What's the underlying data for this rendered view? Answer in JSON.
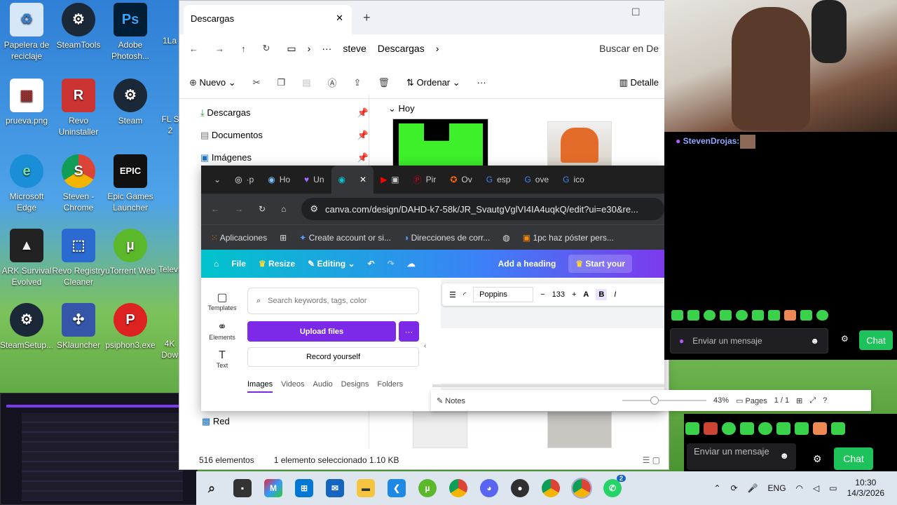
{
  "desktop": {
    "icons": [
      "Papelera de reciclaje",
      "SteamTools",
      "Adobe Photosh...",
      "prueva.png",
      "Revo Uninstaller",
      "Steam",
      "Microsoft Edge",
      "Steven - Chrome",
      "Epic Games Launcher",
      "ARK Survival Evolved",
      "Revo Registry Cleaner",
      "uTorrent Web",
      "SteamSetup...",
      "SKlauncher",
      "psiphon3.exe"
    ],
    "partial": [
      "1La",
      "FL S 2",
      "Televi",
      "4K Dow"
    ]
  },
  "explorer": {
    "tab_title": "Descargas",
    "new_tab": "+",
    "breadcrumb": [
      "steve",
      "Descargas"
    ],
    "search_placeholder": "Buscar en De",
    "new_label": "Nuevo",
    "sort_label": "Ordenar",
    "details_label": "Detalle",
    "nav": [
      "Descargas",
      "Documentos",
      "Imágenes",
      "Red"
    ],
    "group_today": "Hoy",
    "status_count": "516 elementos",
    "status_selected": "1 elemento seleccionado  1.10 KB"
  },
  "chrome": {
    "tabs": [
      "·p",
      "Ho",
      "Un",
      "",
      "Pir",
      "Ov",
      "esp",
      "ove",
      "ico"
    ],
    "url": "canva.com/design/DAHD-k7-58k/JR_SvautgVglVI4IA4uqkQ/edit?ui=e30&re...",
    "bookmarks": [
      "Aplicaciones",
      "Create account or si...",
      "Direcciones de corr...",
      "1pc haz póster pers..."
    ]
  },
  "canva": {
    "file": "File",
    "resize": "Resize",
    "editing": "Editing",
    "add_heading": "Add a heading",
    "start": "Start your",
    "side": [
      "Templates",
      "Elements",
      "Text"
    ],
    "search_placeholder": "Search keywords, tags, color",
    "upload": "Upload files",
    "record": "Record yourself",
    "media_tabs": [
      "Images",
      "Videos",
      "Audio",
      "Designs",
      "Folders"
    ],
    "font": "Poppins",
    "font_size": "133",
    "bold": "B",
    "italic": "I",
    "notes": "Notes",
    "zoom": "43%",
    "pages": "Pages",
    "page_count": "1 / 1"
  },
  "twitch": {
    "username": "StevenDrojas:",
    "placeholder": "Enviar un mensaje",
    "chat_button": "Chat",
    "placeholder2": "Enviar un mensaje",
    "chat_button2": "Chat"
  },
  "taskbar": {
    "lang": "ENG",
    "time": "10:30",
    "date": "14/3/2026",
    "badge": "2"
  }
}
